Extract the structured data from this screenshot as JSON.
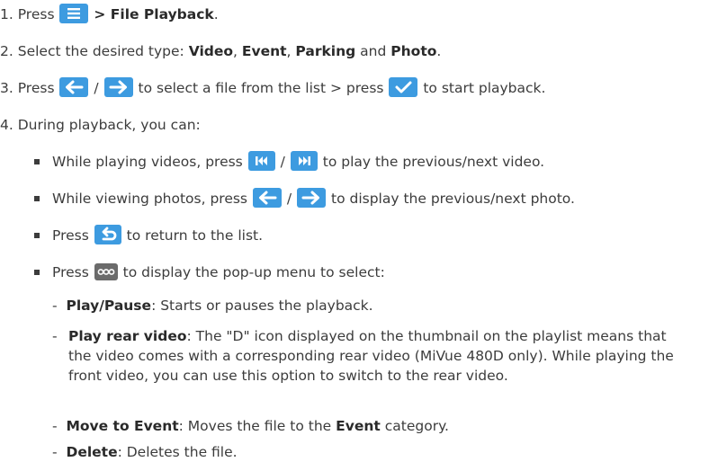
{
  "steps": [
    {
      "num": "1.",
      "press": "Press",
      "after": "> File Playback",
      "end": "."
    },
    {
      "num": "2.",
      "text": "Select the desired type:",
      "types": [
        "Video",
        "Event",
        "Parking",
        "Photo"
      ],
      "sep": ",",
      "and": "and",
      "end": "."
    },
    {
      "num": "3.",
      "press": "Press",
      "slash": "/",
      "mid": "to select a file from the list > press",
      "end": "to start playback."
    },
    {
      "num": "4.",
      "text": "During playback, you can:"
    }
  ],
  "bullets": [
    {
      "pre": "While playing videos, press",
      "slash": "/",
      "post": "to play the previous/next video."
    },
    {
      "pre": "While viewing photos, press",
      "slash": "/",
      "post": "to display the previous/next photo."
    },
    {
      "pre": "Press",
      "post": "to return to the list."
    },
    {
      "pre": "Press",
      "post": "to display the pop-up menu to select:"
    }
  ],
  "menu_items": [
    {
      "dash": "-",
      "term": "Play/Pause",
      "desc": ": Starts or pauses the playback."
    },
    {
      "dash": "-",
      "term": "Play rear video",
      "desc": ": The \"D\" icon displayed on the thumbnail on the playlist means that the video comes with a corresponding rear video (MiVue 480D only). While playing the front video, you can use this option to switch to the rear video."
    },
    {
      "dash": "-",
      "term": "Move to Event",
      "desc1": ": Moves the file to the",
      "term2": "Event",
      "desc2": "category."
    },
    {
      "dash": "-",
      "term": "Delete",
      "desc": ": Deletes the file."
    }
  ],
  "icons": {
    "menu": "hamburger-menu-icon",
    "left": "left-arrow-icon",
    "right": "right-arrow-icon",
    "confirm": "check-icon",
    "prev": "skip-previous-icon",
    "next": "skip-next-icon",
    "back": "return-icon",
    "more": "more-options-icon"
  },
  "colors": {
    "button_blue": "#3d9be0",
    "button_gray": "#6b6b6b",
    "text": "#3c3c3c"
  }
}
